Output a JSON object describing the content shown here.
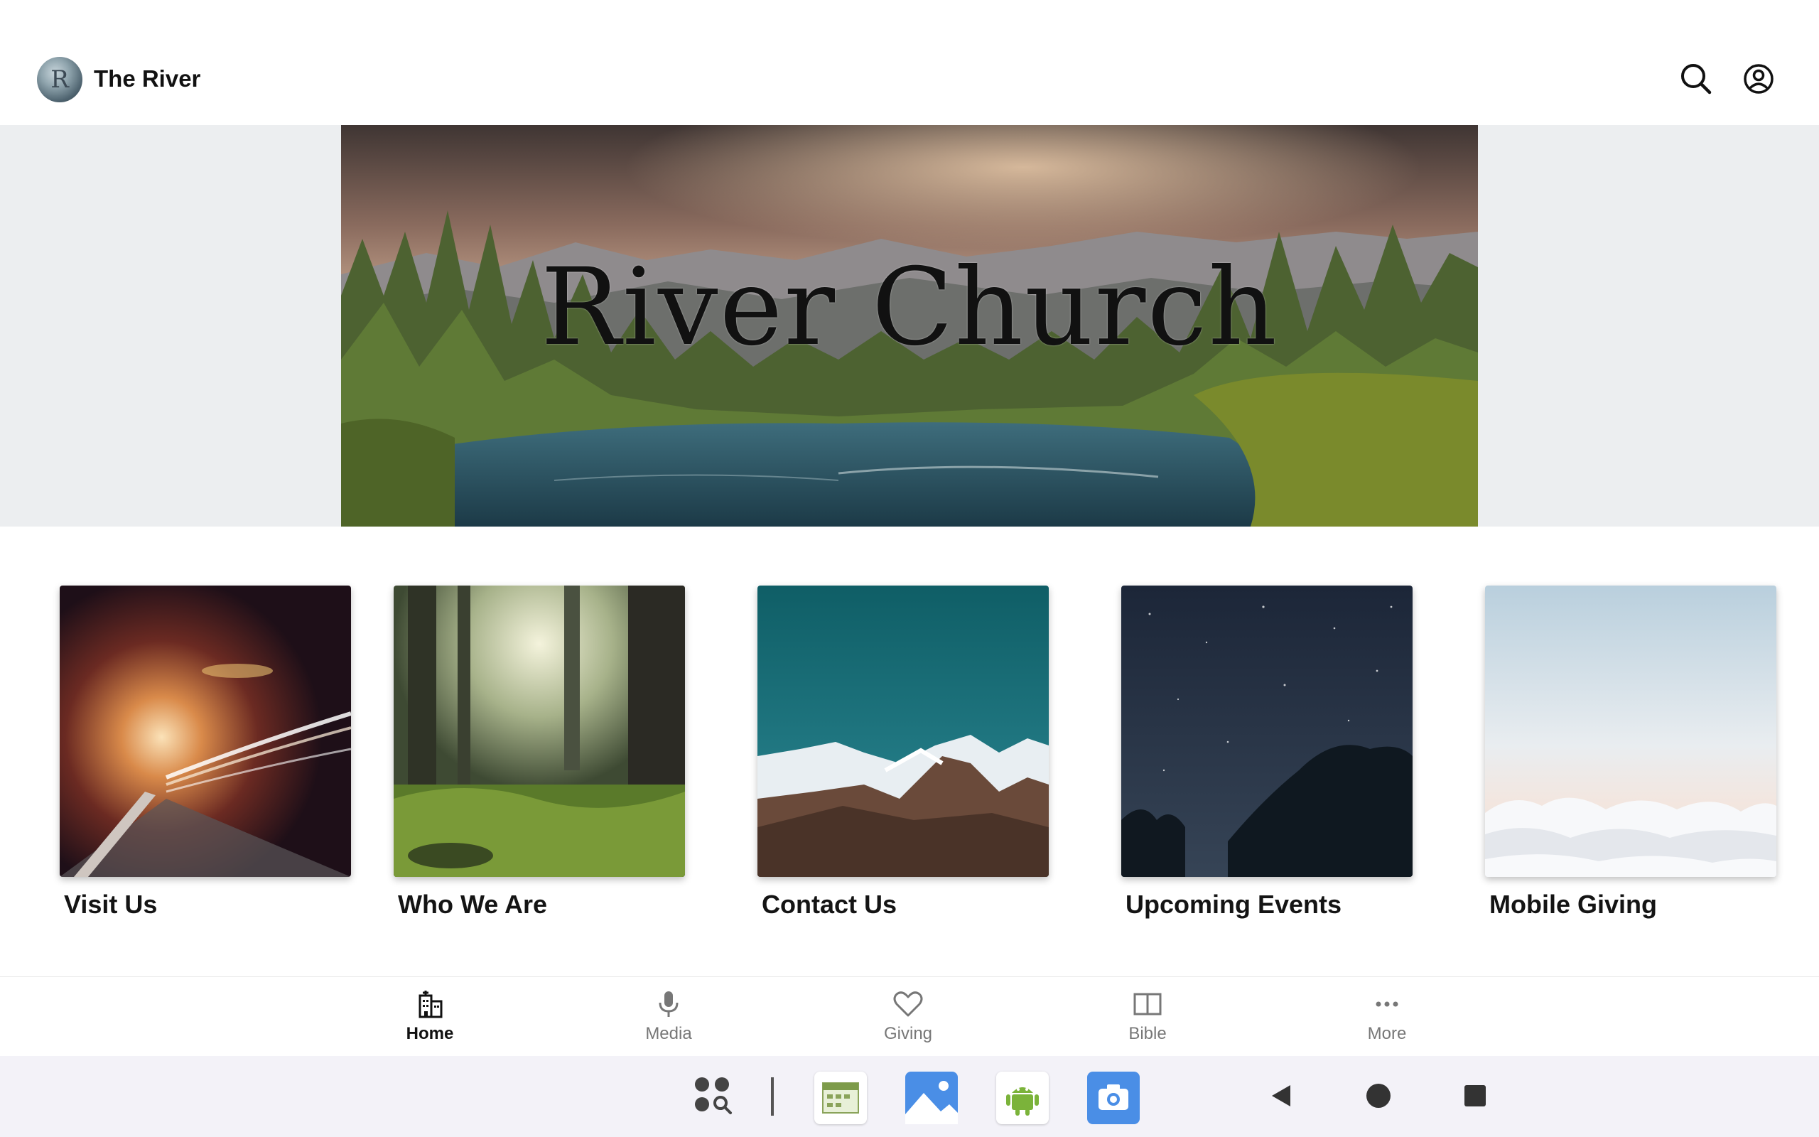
{
  "header": {
    "title": "The River",
    "avatar_letter": "R",
    "icons": [
      "search-icon",
      "account-icon"
    ]
  },
  "hero": {
    "title": "River Church"
  },
  "tiles": [
    {
      "label": "Visit Us"
    },
    {
      "label": "Who We Are"
    },
    {
      "label": "Contact Us"
    },
    {
      "label": "Upcoming Events"
    },
    {
      "label": "Mobile Giving"
    }
  ],
  "bottom_nav": {
    "active": "Home",
    "items": [
      {
        "label": "Home",
        "icon": "church-building-icon"
      },
      {
        "label": "Media",
        "icon": "microphone-icon"
      },
      {
        "label": "Giving",
        "icon": "heart-icon"
      },
      {
        "label": "Bible",
        "icon": "open-book-icon"
      },
      {
        "label": "More",
        "icon": "more-dots-icon"
      }
    ]
  },
  "system_bar": {
    "apps": [
      "app-drawer-search-icon",
      "calendar-app-icon",
      "gallery-app-icon",
      "android-app-icon",
      "camera-app-icon"
    ],
    "nav": [
      "back-icon",
      "home-icon",
      "recents-icon"
    ]
  },
  "colors": {
    "accent_blue": "#4a8ee6",
    "nav_active": "#111111",
    "nav_inactive": "#777777",
    "hero_band": "#eceef0"
  }
}
